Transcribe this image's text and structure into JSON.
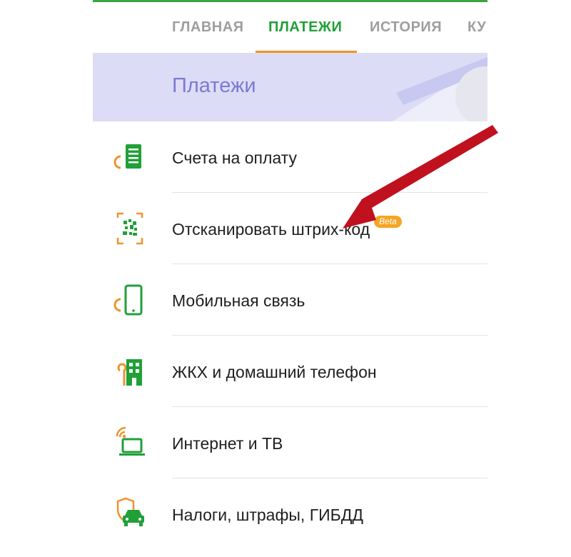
{
  "tabs": [
    {
      "label": "ГЛАВНАЯ",
      "active": false
    },
    {
      "label": "ПЛАТЕЖИ",
      "active": true
    },
    {
      "label": "ИСТОРИЯ",
      "active": false
    },
    {
      "label": "КУ",
      "active": false
    }
  ],
  "banner": {
    "title": "Платежи"
  },
  "payments": [
    {
      "label": "Счета на оплату",
      "icon": "invoice-icon"
    },
    {
      "label": "Отсканировать штрих-код",
      "icon": "barcode-scan-icon",
      "badge": "Beta"
    },
    {
      "label": "Мобильная связь",
      "icon": "mobile-phone-icon"
    },
    {
      "label": "ЖКХ и домашний телефон",
      "icon": "housing-icon"
    },
    {
      "label": "Интернет и ТВ",
      "icon": "internet-tv-icon"
    },
    {
      "label": "Налоги, штрафы, ГИБДД",
      "icon": "car-fines-icon"
    }
  ],
  "colors": {
    "accent_green": "#21a038",
    "accent_orange": "#f0932b",
    "banner_bg": "#dcdcf6",
    "banner_text": "#7b7bd3",
    "annotation_arrow": "#c0111f"
  }
}
